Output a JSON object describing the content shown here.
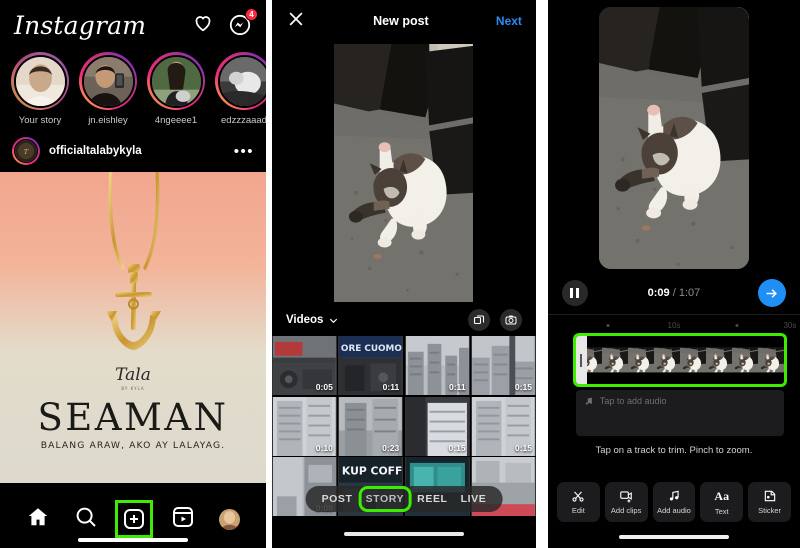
{
  "panel1": {
    "name": "instagram-feed",
    "app_title": "Instagram",
    "icons": {
      "heart": "heart-icon",
      "messenger": "messenger-icon"
    },
    "messages_badge": "4",
    "stories": [
      {
        "label": "Your story",
        "own": true
      },
      {
        "label": "jn.eishley",
        "own": false
      },
      {
        "label": "4ngeeee1",
        "own": false
      },
      {
        "label": "edzzzaaad",
        "own": false
      }
    ],
    "post": {
      "username": "officialtalabykyla",
      "menu": "•••",
      "overlay_script": "Tala",
      "overlay_title": "SEAMAN",
      "overlay_subtitle": "BALANG ARAW, AKO AY LALAYAG."
    },
    "nav": [
      {
        "label": "Home",
        "icon": "home-icon",
        "highlighted": false
      },
      {
        "label": "Search",
        "icon": "search-icon",
        "highlighted": false
      },
      {
        "label": "Create",
        "icon": "plus-square-icon",
        "highlighted": true
      },
      {
        "label": "Reels",
        "icon": "reels-icon",
        "highlighted": false
      },
      {
        "label": "Profile",
        "icon": "avatar-icon",
        "highlighted": false
      }
    ]
  },
  "panel2": {
    "name": "new-post-picker",
    "close": "close-icon",
    "title": "New post",
    "next_label": "Next",
    "filter_label": "Videos",
    "filter_chevron": "chevron-down-icon",
    "multiselect_icon": "multiselect-icon",
    "camera_icon": "camera-icon",
    "thumbnails": [
      {
        "duration": "0:05"
      },
      {
        "duration": "0:11"
      },
      {
        "duration": "0:11"
      },
      {
        "duration": "0:15"
      },
      {
        "duration": "0:10"
      },
      {
        "duration": "0:23"
      },
      {
        "duration": "0:15"
      },
      {
        "duration": "0:15"
      },
      {
        "duration": "0:08"
      },
      {
        "duration": ""
      },
      {
        "duration": ""
      },
      {
        "duration": ""
      }
    ],
    "modes": [
      {
        "label": "POST",
        "highlighted": false
      },
      {
        "label": "STORY",
        "highlighted": true
      },
      {
        "label": "REEL",
        "highlighted": false
      },
      {
        "label": "LIVE",
        "highlighted": false
      }
    ]
  },
  "panel3": {
    "name": "story-video-editor",
    "pause_icon": "pause-icon",
    "current_time": "0:09",
    "time_separator": "/",
    "total_time": "1:07",
    "next_icon": "arrow-right-icon",
    "ruler": [
      {
        "label": "",
        "pos": 24
      },
      {
        "label": "10s",
        "pos": 50
      },
      {
        "label": "",
        "pos": 75
      },
      {
        "label": "30s",
        "pos": 97
      }
    ],
    "clip_track_highlighted": true,
    "audio_placeholder": "Tap to add audio",
    "audio_icon": "music-note-icon",
    "hint": "Tap on a track to trim. Pinch to zoom.",
    "tools": [
      {
        "label": "Edit",
        "icon": "scissors-icon"
      },
      {
        "label": "Add clips",
        "icon": "add-clips-icon"
      },
      {
        "label": "Add audio",
        "icon": "music-note-icon"
      },
      {
        "label": "Text",
        "icon": "text-aa-icon"
      },
      {
        "label": "Sticker",
        "icon": "sticker-icon"
      }
    ]
  },
  "colors": {
    "highlight": "#3dec00",
    "accent_blue": "#1f8ff5",
    "link_blue": "#2a8cf0",
    "badge_red": "#ff2a42"
  }
}
